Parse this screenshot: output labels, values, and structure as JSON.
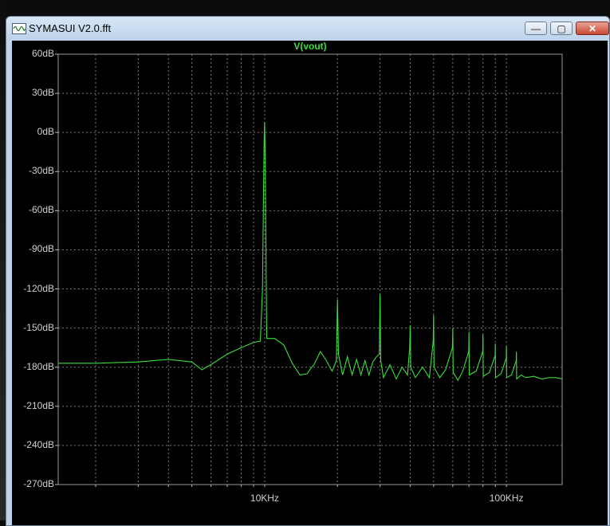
{
  "window": {
    "title": "SYMASUI V2.0.fft",
    "min_label": "—",
    "max_label": "▢",
    "close_label": "✕"
  },
  "colors": {
    "trace": "#3cdc3c",
    "grid": "#7a7a7a",
    "background": "#000000",
    "axis_text": "#cfcfcf"
  },
  "chart_data": {
    "type": "line",
    "title": "V(vout)",
    "x_scale": "log",
    "y_unit": "dB",
    "xlim_hz": [
      1400,
      170000
    ],
    "ylim": [
      -270,
      60
    ],
    "yticks": [
      60,
      30,
      0,
      -30,
      -60,
      -90,
      -120,
      -150,
      -180,
      -210,
      -240,
      -270
    ],
    "ytick_labels": [
      "60dB",
      "30dB",
      "0dB",
      "-30dB",
      "-60dB",
      "-90dB",
      "-120dB",
      "-150dB",
      "-180dB",
      "-210dB",
      "-240dB",
      "-270dB"
    ],
    "xticks_hz": [
      10000,
      100000
    ],
    "xtick_labels": [
      "10KHz",
      "100KHz"
    ],
    "grid": true,
    "series": [
      {
        "name": "V(vout)",
        "x_hz": [
          1400,
          2000,
          3000,
          4000,
          5000,
          5500,
          6000,
          7000,
          8000,
          9000,
          9600,
          9800,
          9950,
          10000,
          10050,
          10200,
          10400,
          11000,
          12000,
          13000,
          14000,
          15000,
          15500,
          16000,
          17000,
          18000,
          19000,
          19800,
          20000,
          20200,
          21000,
          22000,
          23000,
          24000,
          25000,
          26000,
          27000,
          28000,
          29000,
          29800,
          30000,
          30200,
          31000,
          33000,
          35000,
          37000,
          39000,
          39800,
          40000,
          40200,
          42000,
          45000,
          48000,
          49800,
          50000,
          50200,
          53000,
          56000,
          59800,
          60000,
          60200,
          63000,
          66000,
          69800,
          70000,
          70200,
          75000,
          79800,
          80000,
          80200,
          85000,
          89800,
          90000,
          90200,
          95000,
          99800,
          100000,
          100200,
          105000,
          109800,
          110000,
          110200,
          115000,
          120000,
          130000,
          140000,
          150000,
          160000,
          170000
        ],
        "y_db": [
          -177,
          -177,
          -176,
          -174,
          -176,
          -182,
          -178,
          -170,
          -165,
          -161,
          -160,
          -120,
          -8,
          8,
          -20,
          -158,
          -158,
          -158,
          -163,
          -177,
          -186,
          -185,
          -181,
          -178,
          -168,
          -175,
          -183,
          -175,
          -128,
          -170,
          -186,
          -172,
          -186,
          -174,
          -186,
          -175,
          -186,
          -176,
          -172,
          -170,
          -124,
          -175,
          -188,
          -178,
          -189,
          -180,
          -186,
          -165,
          -148,
          -180,
          -188,
          -180,
          -188,
          -160,
          -140,
          -180,
          -188,
          -182,
          -165,
          -150,
          -184,
          -190,
          -183,
          -168,
          -153,
          -186,
          -183,
          -168,
          -155,
          -187,
          -184,
          -171,
          -162,
          -188,
          -185,
          -173,
          -164,
          -188,
          -186,
          -175,
          -168,
          -189,
          -186,
          -188,
          -187,
          -189,
          -188,
          -188,
          -189
        ]
      }
    ]
  }
}
